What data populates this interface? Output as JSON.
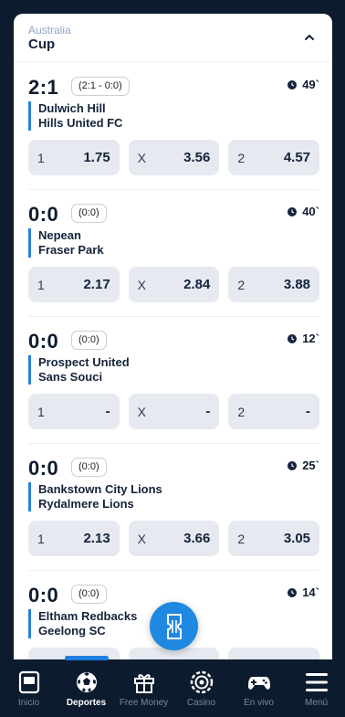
{
  "league": {
    "country": "Australia",
    "name": "Cup"
  },
  "matches": [
    {
      "score": "2:1",
      "halftime": "(2:1 - 0:0)",
      "minute": "49`",
      "home": "Dulwich Hill",
      "away": "Hills United FC",
      "odds": [
        {
          "label": "1",
          "value": "1.75"
        },
        {
          "label": "X",
          "value": "3.56"
        },
        {
          "label": "2",
          "value": "4.57"
        }
      ]
    },
    {
      "score": "0:0",
      "halftime": "(0:0)",
      "minute": "40`",
      "home": "Nepean",
      "away": "Fraser Park",
      "odds": [
        {
          "label": "1",
          "value": "2.17"
        },
        {
          "label": "X",
          "value": "2.84"
        },
        {
          "label": "2",
          "value": "3.88"
        }
      ]
    },
    {
      "score": "0:0",
      "halftime": "(0:0)",
      "minute": "12`",
      "home": "Prospect United",
      "away": "Sans Souci",
      "odds": [
        {
          "label": "1",
          "value": "-"
        },
        {
          "label": "X",
          "value": "-"
        },
        {
          "label": "2",
          "value": "-"
        }
      ]
    },
    {
      "score": "0:0",
      "halftime": "(0:0)",
      "minute": "25`",
      "home": "Bankstown City Lions",
      "away": "Rydalmere Lions",
      "odds": [
        {
          "label": "1",
          "value": "2.13"
        },
        {
          "label": "X",
          "value": "3.66"
        },
        {
          "label": "2",
          "value": "3.05"
        }
      ]
    },
    {
      "score": "0:0",
      "halftime": "(0:0)",
      "minute": "14`",
      "home": "Eltham Redbacks",
      "away": "Geelong SC",
      "odds": [
        {
          "label": "",
          "value": ""
        },
        {
          "label": "",
          "value": ""
        },
        {
          "label": "",
          "value": ""
        }
      ]
    }
  ],
  "nav": [
    {
      "label": "Inicio",
      "icon": "home-icon"
    },
    {
      "label": "Deportes",
      "icon": "soccer-ball-icon",
      "active": true
    },
    {
      "label": "Free Money",
      "icon": "gift-icon"
    },
    {
      "label": "Casino",
      "icon": "casino-chip-icon"
    },
    {
      "label": "En vivo",
      "icon": "gamepad-icon"
    },
    {
      "label": "Menú",
      "icon": "hamburger-menu-icon"
    }
  ],
  "colors": {
    "accent": "#1f88e0",
    "team_bar": "#2a7fe0",
    "nav_bg": "#0d1b2e",
    "odd_bg": "#e6e9f0"
  },
  "betslip": {
    "icon": "ticket-icon"
  }
}
